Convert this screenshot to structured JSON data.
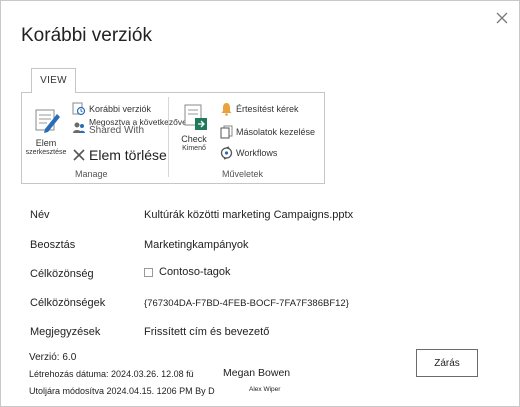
{
  "dialog": {
    "title": "Korábbi verziók",
    "close_icon": "close-icon"
  },
  "ribbon": {
    "tab_label": "VIEW",
    "manage": {
      "edit_item_line1": "Elem",
      "edit_item_line2": "szerkesztése",
      "version_history": "Korábbi verziók",
      "shared_with_line1": "Megosztva a következővel:",
      "shared_with_line2": "Shared With",
      "delete_item": "Elem törlése",
      "group_label": "Manage"
    },
    "actions": {
      "check_out_line1": "Check",
      "check_out_line2": "Kimenő",
      "alert_me": "Értesítést kérek",
      "manage_copies": "Másolatok kezelése",
      "workflows": "Workflows",
      "group_label": "Műveletek"
    }
  },
  "properties": [
    {
      "key": "Név",
      "value": "Kultúrák közötti marketing Campaigns.pptx"
    },
    {
      "key": "Beosztás",
      "value": "Marketingkampányok"
    },
    {
      "key": "Célközönség",
      "value": "Contoso-tagok"
    },
    {
      "key": "Célközönségek",
      "value": "{767304DA-F7BD-4FEB-BOCF-7FA7F386BF12}"
    },
    {
      "key": "Megjegyzések",
      "value": "Frissített cím és bevezető"
    }
  ],
  "footer": {
    "version": "Verzió: 6.0",
    "created": "Létrehozás dátuma: 2024.03.26. 12.08 fü",
    "created_by": "Megan Bowen",
    "modified": "Utoljára módosítva 2024.04.15. 1206 PM By D",
    "modified_by": "Alex Wiper"
  },
  "buttons": {
    "close_label": "Zárás"
  },
  "colors": {
    "accent_blue": "#2b6cb8",
    "alert_orange": "#e8a33c",
    "border": "#c6c6c6"
  }
}
